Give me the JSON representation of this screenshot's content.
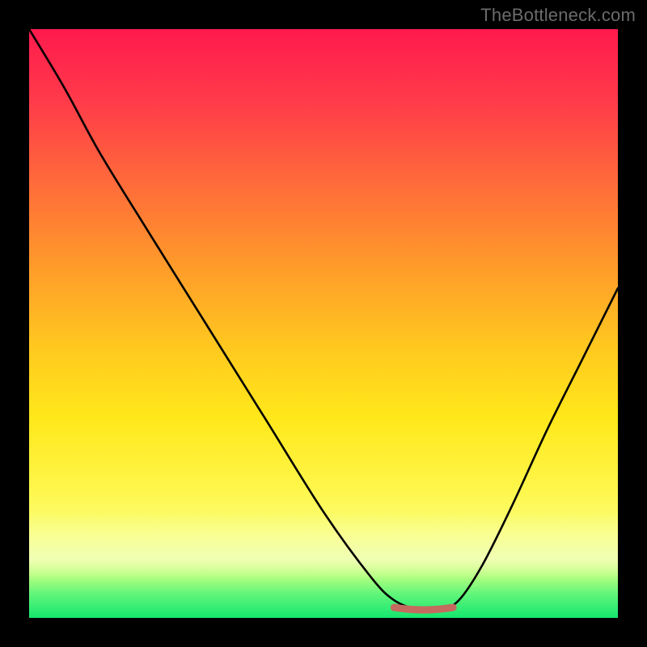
{
  "watermark": "TheBottleneck.com",
  "colors": {
    "frame": "#000000",
    "curve": "#000000",
    "flat_segment": "#c56a5e",
    "gradient_top": "#ff1a4d",
    "gradient_bottom": "#14e76e"
  },
  "chart_data": {
    "type": "line",
    "title": "",
    "xlabel": "",
    "ylabel": "",
    "xlim": [
      0,
      100
    ],
    "ylim": [
      0,
      100
    ],
    "grid": false,
    "legend": false,
    "series": [
      {
        "name": "bottleneck-curve",
        "x": [
          0,
          6,
          12,
          20,
          30,
          40,
          50,
          58,
          62,
          66,
          70,
          73,
          77,
          82,
          88,
          94,
          100
        ],
        "y": [
          100,
          90,
          79,
          66,
          50,
          34,
          18,
          7,
          3,
          1.5,
          1.5,
          3,
          9,
          19,
          32,
          44,
          56
        ]
      }
    ],
    "flat_segment": {
      "x_start": 62,
      "x_end": 72,
      "y": 1.5,
      "note": "short reddish marker along the curve bottom"
    },
    "background": {
      "type": "vertical-gradient",
      "stops": [
        {
          "pos": 0.0,
          "color": "#ff1a4d"
        },
        {
          "pos": 0.12,
          "color": "#ff3a4a"
        },
        {
          "pos": 0.26,
          "color": "#ff6a3a"
        },
        {
          "pos": 0.4,
          "color": "#ff9a2a"
        },
        {
          "pos": 0.54,
          "color": "#ffc81f"
        },
        {
          "pos": 0.66,
          "color": "#ffe81a"
        },
        {
          "pos": 0.78,
          "color": "#fff64a"
        },
        {
          "pos": 0.86,
          "color": "#f8ff7a"
        },
        {
          "pos": 0.9,
          "color": "#dfff88"
        },
        {
          "pos": 0.93,
          "color": "#b0ff80"
        },
        {
          "pos": 0.96,
          "color": "#60f57a"
        },
        {
          "pos": 1.0,
          "color": "#14e76e"
        }
      ]
    }
  }
}
